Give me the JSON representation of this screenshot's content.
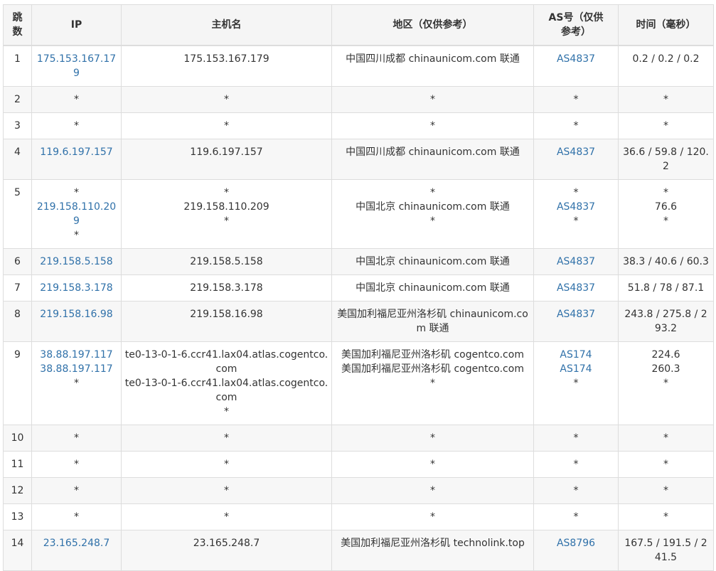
{
  "headers": {
    "hop": "跳数",
    "ip": "IP",
    "host": "主机名",
    "region": "地区（仅供参考）",
    "as": "AS号（仅供参考）",
    "time": "时间（毫秒）"
  },
  "link_color": "#3071a9",
  "rows": [
    {
      "hop": "1",
      "ip": [
        "175.153.167.179"
      ],
      "host": [
        "175.153.167.179"
      ],
      "region": [
        "中国四川成都 chinaunicom.com 联通"
      ],
      "as": [
        "AS4837"
      ],
      "time": [
        "0.2 / 0.2 / 0.2"
      ]
    },
    {
      "hop": "2",
      "ip": [
        "*"
      ],
      "host": [
        "*"
      ],
      "region": [
        "*"
      ],
      "as": [
        "*"
      ],
      "time": [
        "*"
      ]
    },
    {
      "hop": "3",
      "ip": [
        "*"
      ],
      "host": [
        "*"
      ],
      "region": [
        "*"
      ],
      "as": [
        "*"
      ],
      "time": [
        "*"
      ]
    },
    {
      "hop": "4",
      "ip": [
        "119.6.197.157"
      ],
      "host": [
        "119.6.197.157"
      ],
      "region": [
        "中国四川成都 chinaunicom.com 联通"
      ],
      "as": [
        "AS4837"
      ],
      "time": [
        "36.6 / 59.8 / 120.2"
      ]
    },
    {
      "hop": "5",
      "ip": [
        "*",
        "219.158.110.209",
        "*"
      ],
      "host": [
        "*",
        "219.158.110.209",
        "*"
      ],
      "region": [
        "*",
        "中国北京 chinaunicom.com 联通",
        "*"
      ],
      "as": [
        "*",
        "AS4837",
        "*"
      ],
      "time": [
        "*",
        "76.6",
        "*"
      ]
    },
    {
      "hop": "6",
      "ip": [
        "219.158.5.158"
      ],
      "host": [
        "219.158.5.158"
      ],
      "region": [
        "中国北京 chinaunicom.com 联通"
      ],
      "as": [
        "AS4837"
      ],
      "time": [
        "38.3 / 40.6 / 60.3"
      ]
    },
    {
      "hop": "7",
      "ip": [
        "219.158.3.178"
      ],
      "host": [
        "219.158.3.178"
      ],
      "region": [
        "中国北京 chinaunicom.com 联通"
      ],
      "as": [
        "AS4837"
      ],
      "time": [
        "51.8 / 78 / 87.1"
      ]
    },
    {
      "hop": "8",
      "ip": [
        "219.158.16.98"
      ],
      "host": [
        "219.158.16.98"
      ],
      "region": [
        "美国加利福尼亚州洛杉矶 chinaunicom.com 联通"
      ],
      "as": [
        "AS4837"
      ],
      "time": [
        "243.8 / 275.8 / 293.2"
      ]
    },
    {
      "hop": "9",
      "ip": [
        "38.88.197.117",
        "38.88.197.117",
        "*"
      ],
      "host": [
        "te0-13-0-1-6.ccr41.lax04.atlas.cogentco.com",
        "te0-13-0-1-6.ccr41.lax04.atlas.cogentco.com",
        "*"
      ],
      "region": [
        "美国加利福尼亚州洛杉矶 cogentco.com",
        "美国加利福尼亚州洛杉矶 cogentco.com",
        "*"
      ],
      "as": [
        "AS174",
        "AS174",
        "*"
      ],
      "time": [
        "224.6",
        "260.3",
        "*"
      ]
    },
    {
      "hop": "10",
      "ip": [
        "*"
      ],
      "host": [
        "*"
      ],
      "region": [
        "*"
      ],
      "as": [
        "*"
      ],
      "time": [
        "*"
      ]
    },
    {
      "hop": "11",
      "ip": [
        "*"
      ],
      "host": [
        "*"
      ],
      "region": [
        "*"
      ],
      "as": [
        "*"
      ],
      "time": [
        "*"
      ]
    },
    {
      "hop": "12",
      "ip": [
        "*"
      ],
      "host": [
        "*"
      ],
      "region": [
        "*"
      ],
      "as": [
        "*"
      ],
      "time": [
        "*"
      ]
    },
    {
      "hop": "13",
      "ip": [
        "*"
      ],
      "host": [
        "*"
      ],
      "region": [
        "*"
      ],
      "as": [
        "*"
      ],
      "time": [
        "*"
      ]
    },
    {
      "hop": "14",
      "ip": [
        "23.165.248.7"
      ],
      "host": [
        "23.165.248.7"
      ],
      "region": [
        "美国加利福尼亚州洛杉矶 technolink.top"
      ],
      "as": [
        "AS8796"
      ],
      "time": [
        "167.5 / 191.5 / 241.5"
      ]
    }
  ]
}
